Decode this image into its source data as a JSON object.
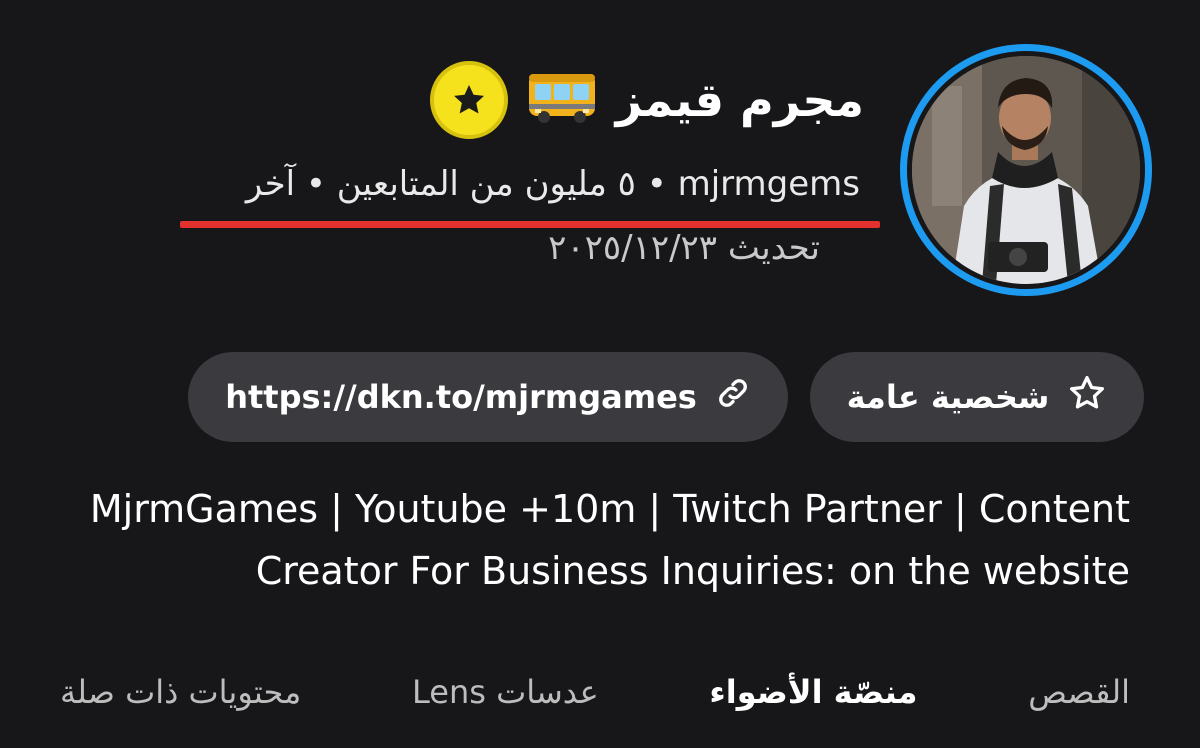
{
  "profile": {
    "display_name": "مجرم قيمز",
    "meta_line": "mjrmgems • ٥ مليون من المتابعين • آخر",
    "updated_line": "تحديث ٢٠٢٥/١٢/٢٣",
    "underline_color": "#e3312d",
    "avatar_ring_color": "#1d9bf0",
    "badge_color": "#f6e11d"
  },
  "chips": {
    "public_label": "شخصية عامة",
    "public_icon": "star-outline-icon",
    "link_label": "https://dkn.to/mjrmgames",
    "link_icon": "link-icon"
  },
  "bio": {
    "line1": "MjrmGames | Youtube +10m | Twitch Partner | Content",
    "line2": "Creator For Business Inquiries: on the website"
  },
  "tabs": [
    {
      "label": "القصص"
    },
    {
      "label": "منصّة الأضواء"
    },
    {
      "label": "عدسات Lens"
    },
    {
      "label": "محتويات ذات صلة"
    }
  ]
}
